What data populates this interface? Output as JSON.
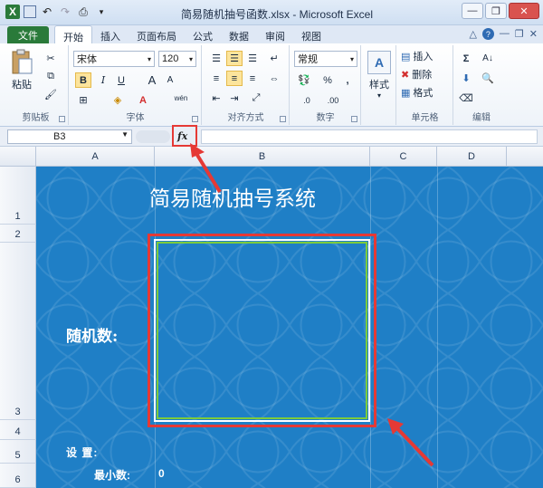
{
  "window": {
    "title": "简易随机抽号函数.xlsx - Microsoft Excel"
  },
  "ribbon_tabs": {
    "file": "文件",
    "items": [
      "开始",
      "插入",
      "页面布局",
      "公式",
      "数据",
      "审阅",
      "视图"
    ],
    "active": "开始"
  },
  "clipboard": {
    "paste": "粘贴",
    "label": "剪贴板"
  },
  "font": {
    "name": "宋体",
    "size": "120",
    "bold": "B",
    "italic": "I",
    "underline": "U",
    "grow": "A",
    "shrink": "A",
    "label": "字体",
    "wen": "wén"
  },
  "alignment": {
    "label": "对齐方式"
  },
  "number": {
    "format": "常规",
    "percent": "%",
    "comma": ",",
    "inc_dec": ".0",
    "dec_dec": ".00",
    "label": "数字"
  },
  "styles": {
    "label": "样式"
  },
  "cells": {
    "insert": "插入",
    "delete": "删除",
    "format": "格式",
    "label": "单元格"
  },
  "editing": {
    "sum": "Σ",
    "label": "编辑"
  },
  "formula_bar": {
    "name_box": "B3",
    "fx": "fx",
    "value": ""
  },
  "columns": [
    "A",
    "B",
    "C",
    "D"
  ],
  "rows": [
    "1",
    "2",
    "3",
    "4",
    "5",
    "6"
  ],
  "sheet": {
    "title": "简易随机抽号系统",
    "random_label": "随机数:",
    "setup_label": "设 置:",
    "min_label": "最小数:",
    "min_value": "0"
  },
  "colors": {
    "sheet_background": "#1f7fc6",
    "file_tab": "#2a7a3a",
    "annotation_red": "#e53935",
    "cell_border_green": "#7ccb3c"
  }
}
